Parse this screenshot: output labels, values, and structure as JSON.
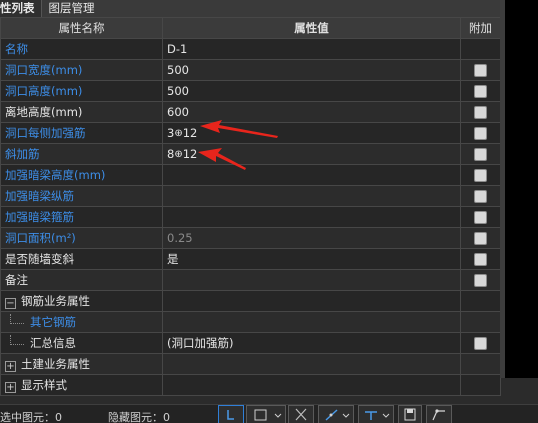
{
  "tabs": [
    {
      "label": "性列表",
      "active": true
    },
    {
      "label": "图层管理",
      "active": false
    }
  ],
  "header": {
    "name": "属性名称",
    "value": "属性值",
    "add": "附加"
  },
  "rows": [
    {
      "name": "名称",
      "value": "D-1",
      "color": "blue",
      "checkbox": false
    },
    {
      "name": "洞口宽度(mm)",
      "value": "500",
      "color": "blue",
      "checkbox": true
    },
    {
      "name": "洞口高度(mm)",
      "value": "500",
      "color": "blue",
      "checkbox": true
    },
    {
      "name": "离地高度(mm)",
      "value": "600",
      "color": "white",
      "checkbox": true
    },
    {
      "name": "洞口每侧加强筋",
      "value_prefix": "3",
      "value_suffix": "12",
      "color": "blue",
      "checkbox": true
    },
    {
      "name": "斜加筋",
      "value_prefix": "8",
      "value_suffix": "12",
      "color": "blue",
      "checkbox": true
    },
    {
      "name": "加强暗梁高度(mm)",
      "value": "",
      "color": "blue",
      "checkbox": true
    },
    {
      "name": "加强暗梁纵筋",
      "value": "",
      "color": "blue",
      "checkbox": true
    },
    {
      "name": "加强暗梁箍筋",
      "value": "",
      "color": "blue",
      "checkbox": true
    },
    {
      "name": "洞口面积(m²)",
      "value": "0.25",
      "color": "blue",
      "value_gray": true,
      "checkbox": true
    },
    {
      "name": "是否随墙变斜",
      "value": "是",
      "color": "white",
      "checkbox": true
    },
    {
      "name": "备注",
      "value": "",
      "color": "white",
      "checkbox": true
    }
  ],
  "tree": {
    "rebar_group": {
      "label": "钢筋业务属性",
      "toggle": "−"
    },
    "rebar_other": {
      "label": "其它钢筋"
    },
    "rebar_summary": {
      "label": "汇总信息",
      "value": "(洞口加强筋)"
    },
    "civil_group": {
      "label": "土建业务属性",
      "toggle": "+"
    },
    "display_group": {
      "label": "显示样式",
      "toggle": "+"
    }
  },
  "rebar_symbol": "⊕",
  "status": {
    "selected": "选中图元：0",
    "hidden": "隐藏图元：0"
  },
  "colors": {
    "blue": "#3d8ee8",
    "arrow": "#e8251c",
    "background": "#2b2b2b"
  }
}
